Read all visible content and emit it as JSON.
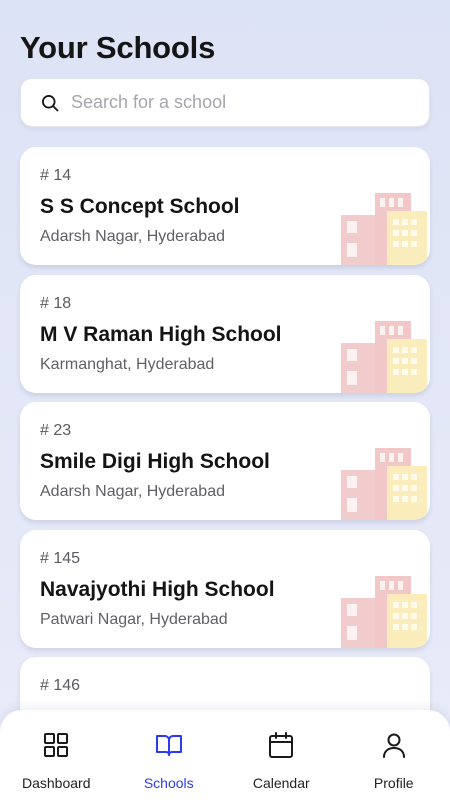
{
  "header": {
    "title": "Your Schools"
  },
  "search": {
    "placeholder": "Search for a school",
    "icon": "search-icon"
  },
  "schools": [
    {
      "number": "# 14",
      "name": "S S Concept School",
      "location": "Adarsh Nagar, Hyderabad"
    },
    {
      "number": "# 18",
      "name": "M V Raman High School",
      "location": "Karmanghat, Hyderabad"
    },
    {
      "number": "# 23",
      "name": "Smile Digi High School",
      "location": "Adarsh Nagar, Hyderabad"
    },
    {
      "number": "# 145",
      "name": "Navajyothi High School",
      "location": "Patwari Nagar, Hyderabad"
    },
    {
      "number": "# 146",
      "name": "",
      "location": ""
    }
  ],
  "nav": {
    "items": [
      {
        "label": "Dashboard",
        "icon": "grid-icon"
      },
      {
        "label": "Schools",
        "icon": "book-icon",
        "active": true
      },
      {
        "label": "Calendar",
        "icon": "calendar-icon"
      },
      {
        "label": "Profile",
        "icon": "person-icon"
      }
    ],
    "active_color": "#2c3bf0"
  },
  "colors": {
    "background": "#dde3f6",
    "card": "#ffffff",
    "building_red": "#e8a8a8",
    "building_yellow": "#f9e08c"
  }
}
